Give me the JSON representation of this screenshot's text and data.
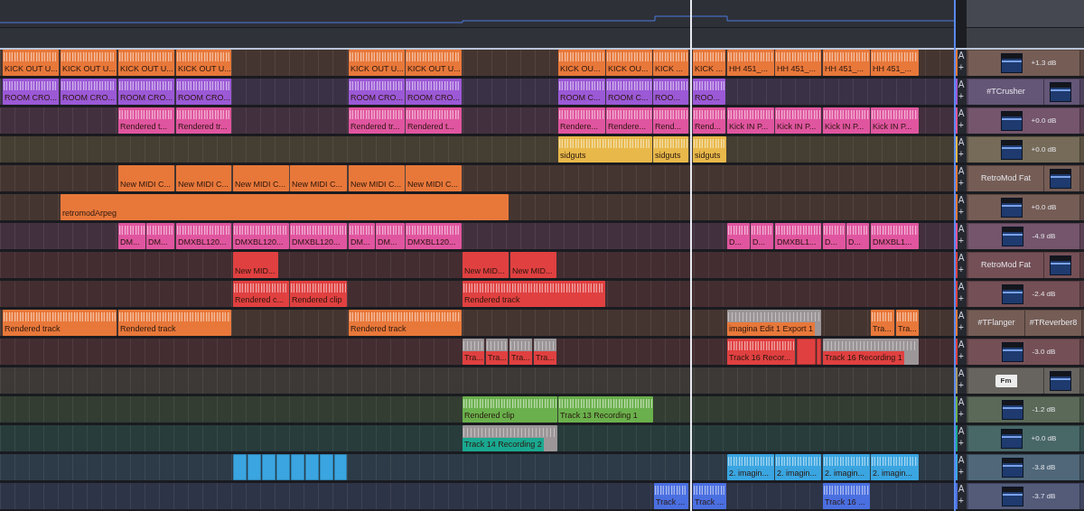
{
  "tracks": [
    {
      "color": "#e8783a",
      "auto_label": "A",
      "add_label": "+",
      "rack": [
        {
          "kind": "volume",
          "reading": "+1.3 dB"
        }
      ],
      "clips": [
        {
          "kind": "audio",
          "label": "KICK OUT U..."
        },
        {
          "kind": "audio",
          "label": "KICK OUT U..."
        },
        {
          "kind": "audio",
          "label": "KICK OUT U..."
        },
        {
          "kind": "audio",
          "label": "KICK OUT U..."
        },
        {
          "kind": "audio",
          "label": "KICK OUT U..."
        },
        {
          "kind": "audio",
          "label": "KICK OUT U..."
        },
        {
          "kind": "audio",
          "label": "KICK OU..."
        },
        {
          "kind": "audio",
          "label": "KICK OU..."
        },
        {
          "kind": "audio",
          "label": "KICK ..."
        },
        {
          "kind": "audio",
          "label": "KICK ..."
        },
        {
          "kind": "audio",
          "label": "HH 451_..."
        },
        {
          "kind": "audio",
          "label": "HH 451_..."
        },
        {
          "kind": "audio",
          "label": "HH 451_..."
        },
        {
          "kind": "audio",
          "label": "HH 451_..."
        }
      ]
    },
    {
      "color": "#9b59d6",
      "auto_label": "A",
      "add_label": "+",
      "rack": [
        {
          "kind": "plugin",
          "label": "#TCrusher"
        },
        {
          "kind": "volume"
        }
      ],
      "clips": [
        {
          "kind": "audio",
          "label": "ROOM CRO..."
        },
        {
          "kind": "audio",
          "label": "ROOM CRO..."
        },
        {
          "kind": "audio",
          "label": "ROOM CRO..."
        },
        {
          "kind": "audio",
          "label": "ROOM CRO..."
        },
        {
          "kind": "audio",
          "label": "ROOM CRO..."
        },
        {
          "kind": "audio",
          "label": "ROOM CRO..."
        },
        {
          "kind": "audio",
          "label": "ROOM C..."
        },
        {
          "kind": "audio",
          "label": "ROOM C..."
        },
        {
          "kind": "audio",
          "label": "ROO..."
        },
        {
          "kind": "audio",
          "label": "ROO..."
        }
      ]
    },
    {
      "color": "#e0559f",
      "auto_label": "A",
      "add_label": "+",
      "rack": [
        {
          "kind": "volume",
          "reading": "+0.0 dB"
        }
      ],
      "clips": [
        {
          "kind": "audio",
          "label": "Rendered t..."
        },
        {
          "kind": "audio",
          "label": "Rendered tr..."
        },
        {
          "kind": "audio",
          "label": "Rendered tr..."
        },
        {
          "kind": "audio",
          "label": "Rendered t..."
        },
        {
          "kind": "audio",
          "label": "Rendere..."
        },
        {
          "kind": "audio",
          "label": "Rendere..."
        },
        {
          "kind": "audio",
          "label": "Rend..."
        },
        {
          "kind": "audio",
          "label": "Rend..."
        },
        {
          "kind": "audio",
          "label": "Kick IN P..."
        },
        {
          "kind": "audio",
          "label": "Kick IN P..."
        },
        {
          "kind": "audio",
          "label": "Kick IN P..."
        },
        {
          "kind": "audio",
          "label": "Kick IN P..."
        }
      ]
    },
    {
      "color": "#e8b84a",
      "auto_label": "A",
      "add_label": "+",
      "rack": [
        {
          "kind": "volume",
          "reading": "+0.0 dB"
        }
      ],
      "clips": [
        {
          "kind": "audio",
          "label": "sidguts"
        },
        {
          "kind": "audio",
          "label": "sidguts"
        },
        {
          "kind": "audio",
          "label": "sidguts"
        }
      ]
    },
    {
      "color": "#e8783a",
      "auto_label": "A",
      "add_label": "+",
      "rack": [
        {
          "kind": "plugin",
          "label": "RetroMod Fat"
        },
        {
          "kind": "volume"
        }
      ],
      "clips": [
        {
          "kind": "midi",
          "label": "New MIDI C..."
        },
        {
          "kind": "midi",
          "label": "New MIDI C..."
        },
        {
          "kind": "midi",
          "label": "New MIDI C..."
        },
        {
          "kind": "midi",
          "label": "New MIDI C..."
        },
        {
          "kind": "midi",
          "label": "New MIDI C..."
        },
        {
          "kind": "midi",
          "label": "New MIDI C..."
        }
      ]
    },
    {
      "color": "#e8783a",
      "auto_label": "A",
      "add_label": "+",
      "rack": [
        {
          "kind": "volume",
          "reading": "+0.0 dB"
        }
      ],
      "clips": [
        {
          "kind": "midi",
          "label": "retromodArpeg"
        }
      ]
    },
    {
      "color": "#e0559f",
      "auto_label": "A",
      "add_label": "+",
      "rack": [
        {
          "kind": "volume",
          "reading": "-4.9 dB"
        }
      ],
      "clips": [
        {
          "kind": "audio",
          "label": "DM..."
        },
        {
          "kind": "audio",
          "label": "DM..."
        },
        {
          "kind": "audio",
          "label": "DMXBL120..."
        },
        {
          "kind": "audio",
          "label": "DMXBL120..."
        },
        {
          "kind": "audio",
          "label": "DMXBL120..."
        },
        {
          "kind": "audio",
          "label": "DM..."
        },
        {
          "kind": "audio",
          "label": "DM..."
        },
        {
          "kind": "audio",
          "label": "DMXBL120..."
        },
        {
          "kind": "audio",
          "label": "D..."
        },
        {
          "kind": "audio",
          "label": "D..."
        },
        {
          "kind": "audio",
          "label": "DMXBL1..."
        },
        {
          "kind": "audio",
          "label": "D..."
        },
        {
          "kind": "audio",
          "label": "D..."
        },
        {
          "kind": "audio",
          "label": "DMXBL1..."
        }
      ]
    },
    {
      "color": "#e04040",
      "auto_label": "A",
      "add_label": "+",
      "rack": [
        {
          "kind": "plugin",
          "label": "RetroMod Fat"
        },
        {
          "kind": "volume"
        }
      ],
      "clips": [
        {
          "kind": "midi",
          "label": "New MID..."
        },
        {
          "kind": "midi",
          "label": "New MID..."
        },
        {
          "kind": "midi",
          "label": "New MID..."
        }
      ]
    },
    {
      "color": "#e04040",
      "auto_label": "A",
      "add_label": "+",
      "rack": [
        {
          "kind": "volume",
          "reading": "-2.4 dB"
        }
      ],
      "clips": [
        {
          "kind": "audio",
          "label": "Rendered c..."
        },
        {
          "kind": "audio",
          "label": "Rendered clip"
        },
        {
          "kind": "audio",
          "label": "Rendered track"
        }
      ]
    },
    {
      "color": "#e8783a",
      "auto_label": "A",
      "add_label": "+",
      "rack": [
        {
          "kind": "plugin",
          "label": "#TFlanger"
        },
        {
          "kind": "plugin",
          "label": "#TReverber8"
        }
      ],
      "clips": [
        {
          "kind": "audio",
          "label": "Rendered track"
        },
        {
          "kind": "audio",
          "label": "Rendered track"
        },
        {
          "kind": "audio",
          "label": "Rendered track"
        },
        {
          "kind": "greyed",
          "label": "imagina Edit 1 Export 1"
        },
        {
          "kind": "audio",
          "label": "Tra..."
        },
        {
          "kind": "audio",
          "label": "Tra..."
        }
      ]
    },
    {
      "color": "#e04040",
      "auto_label": "A",
      "add_label": "+",
      "rack": [
        {
          "kind": "volume",
          "reading": "-3.0 dB"
        }
      ],
      "clips": [
        {
          "kind": "greyed",
          "label": "Tra..."
        },
        {
          "kind": "greyed",
          "label": "Tra..."
        },
        {
          "kind": "greyed",
          "label": "Tra..."
        },
        {
          "kind": "greyed",
          "label": "Tra..."
        },
        {
          "kind": "audio",
          "label": "Track 16 Recor..."
        },
        {
          "kind": "plain"
        },
        {
          "kind": "plain"
        },
        {
          "kind": "greyed",
          "label": "Track 16 Recording 1"
        }
      ]
    },
    {
      "color": "#a8986a",
      "auto_label": "A",
      "add_label": "+",
      "rack": [
        {
          "kind": "tag",
          "label": "Fm"
        },
        {
          "kind": "volume"
        }
      ]
    },
    {
      "color": "#6ab04c",
      "auto_label": "A",
      "add_label": "+",
      "rack": [
        {
          "kind": "volume",
          "reading": "-1.2 dB"
        }
      ],
      "clips": [
        {
          "kind": "audio",
          "label": "Rendered clip"
        },
        {
          "kind": "audio",
          "label": "Track 13 Recording 1"
        }
      ]
    },
    {
      "color": "#1aa890",
      "auto_label": "A",
      "add_label": "+",
      "rack": [
        {
          "kind": "volume",
          "reading": "+0.0 dB"
        }
      ],
      "clips": [
        {
          "kind": "greyed",
          "label": "Track 14 Recording 2"
        }
      ]
    },
    {
      "color": "#3aa5e0",
      "auto_label": "A",
      "add_label": "+",
      "rack": [
        {
          "kind": "volume",
          "reading": "-3.8 dB"
        }
      ],
      "clips": [
        {
          "kind": "plain"
        },
        {
          "kind": "plain"
        },
        {
          "kind": "plain"
        },
        {
          "kind": "plain"
        },
        {
          "kind": "plain"
        },
        {
          "kind": "plain"
        },
        {
          "kind": "plain"
        },
        {
          "kind": "plain"
        },
        {
          "kind": "audio",
          "label": "2. imagin..."
        },
        {
          "kind": "audio",
          "label": "2. imagin..."
        },
        {
          "kind": "audio",
          "label": "2. imagin..."
        },
        {
          "kind": "audio",
          "label": "2. imagin..."
        }
      ]
    },
    {
      "color": "#4a6fe0",
      "auto_label": "A",
      "add_label": "+",
      "rack": [
        {
          "kind": "volume",
          "reading": "-3.7 dB"
        }
      ],
      "clips": [
        {
          "kind": "audio",
          "label": "Track ..."
        },
        {
          "kind": "audio",
          "label": "Track ..."
        },
        {
          "kind": "audio",
          "label": "Track 16 ..."
        }
      ]
    }
  ]
}
